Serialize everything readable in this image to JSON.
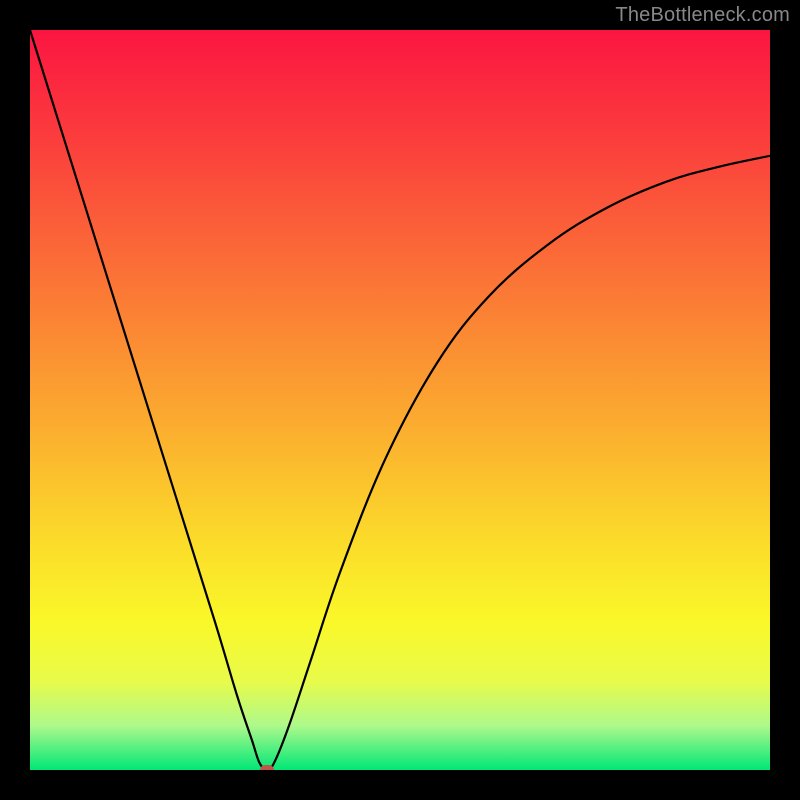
{
  "watermark": "TheBottleneck.com",
  "chart_data": {
    "type": "line",
    "title": "",
    "xlabel": "",
    "ylabel": "",
    "xlim": [
      0,
      100
    ],
    "ylim": [
      0,
      100
    ],
    "series": [
      {
        "name": "bottleneck-curve",
        "x": [
          0,
          5,
          10,
          15,
          20,
          25,
          28,
          30,
          31,
          32,
          33,
          35,
          38,
          42,
          48,
          55,
          62,
          70,
          78,
          86,
          93,
          100
        ],
        "values": [
          100,
          84,
          68,
          52,
          36,
          20,
          10,
          4,
          1,
          0,
          1,
          6,
          15,
          27,
          42,
          55,
          64,
          71,
          76,
          79.5,
          81.5,
          83
        ]
      }
    ],
    "marker": {
      "x": 32,
      "y": 0,
      "color": "#c0564a"
    },
    "background_gradient": {
      "stops": [
        {
          "pct": 0,
          "color": "#fb1541"
        },
        {
          "pct": 14,
          "color": "#fb3b3d"
        },
        {
          "pct": 28,
          "color": "#fb6338"
        },
        {
          "pct": 42,
          "color": "#fb8c33"
        },
        {
          "pct": 56,
          "color": "#fbb42e"
        },
        {
          "pct": 70,
          "color": "#fbde2a"
        },
        {
          "pct": 80,
          "color": "#faf829"
        },
        {
          "pct": 88,
          "color": "#e8fb4a"
        },
        {
          "pct": 94,
          "color": "#aef98b"
        },
        {
          "pct": 100,
          "color": "#00e777"
        }
      ]
    }
  }
}
